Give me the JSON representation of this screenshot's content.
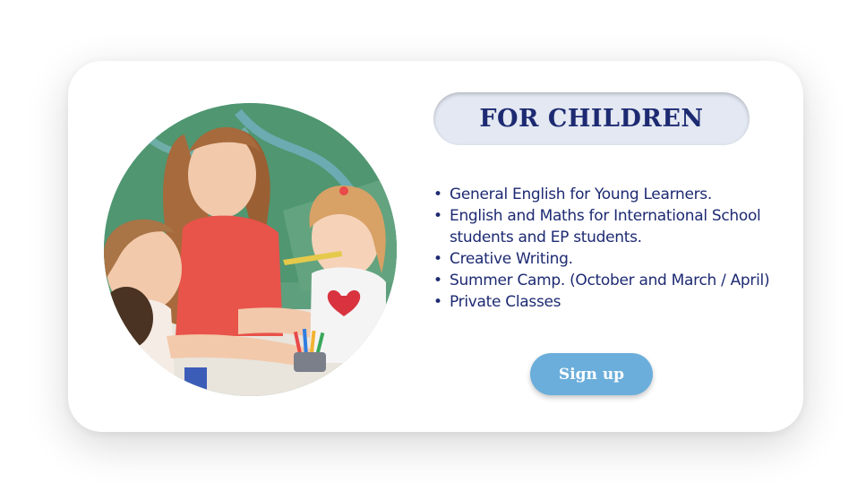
{
  "card": {
    "title": "FOR CHILDREN",
    "courses": [
      "General English for Young Learners.",
      "English and Maths for International School students and EP students.",
      "Creative Writing.",
      "Summer Camp. (October and March / April)",
      "Private Classes"
    ],
    "bullet": "•",
    "signup_label": "Sign up"
  },
  "colors": {
    "title_text": "#1d2a72",
    "title_pill": "#e3e8f2",
    "list_text": "#1d2a72",
    "button_bg": "#6baedb",
    "button_text": "#ffffff",
    "card_bg": "#ffffff"
  },
  "photo": {
    "subject": "teacher-with-children-drawing-photo"
  }
}
